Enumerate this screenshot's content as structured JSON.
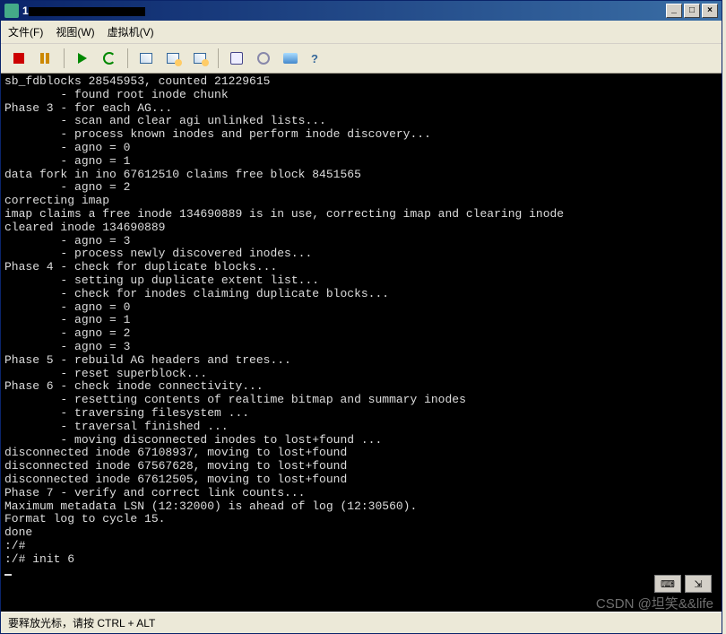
{
  "titlebar": {
    "prefix": "1",
    "redacted": true
  },
  "window_buttons": {
    "min": "_",
    "max": "□",
    "close": "×"
  },
  "menu": {
    "file": "文件(F)",
    "view": "视图(W)",
    "vm": "虚拟机(V)"
  },
  "toolbar": {
    "stop": "stop",
    "pause": "pause",
    "play": "play",
    "refresh": "refresh",
    "snapshot": "snapshot",
    "revert": "revert",
    "manage": "manage",
    "floppy": "floppy",
    "cd": "cd",
    "network": "network",
    "help": "help"
  },
  "terminal": {
    "lines": [
      "sb_fdblocks 28545953, counted 21229615",
      "        - found root inode chunk",
      "Phase 3 - for each AG...",
      "        - scan and clear agi unlinked lists...",
      "        - process known inodes and perform inode discovery...",
      "        - agno = 0",
      "        - agno = 1",
      "data fork in ino 67612510 claims free block 8451565",
      "        - agno = 2",
      "correcting imap",
      "imap claims a free inode 134690889 is in use, correcting imap and clearing inode",
      "cleared inode 134690889",
      "        - agno = 3",
      "        - process newly discovered inodes...",
      "Phase 4 - check for duplicate blocks...",
      "        - setting up duplicate extent list...",
      "        - check for inodes claiming duplicate blocks...",
      "        - agno = 0",
      "        - agno = 1",
      "        - agno = 2",
      "        - agno = 3",
      "Phase 5 - rebuild AG headers and trees...",
      "        - reset superblock...",
      "Phase 6 - check inode connectivity...",
      "        - resetting contents of realtime bitmap and summary inodes",
      "        - traversing filesystem ...",
      "        - traversal finished ...",
      "        - moving disconnected inodes to lost+found ...",
      "disconnected inode 67108937, moving to lost+found",
      "disconnected inode 67567628, moving to lost+found",
      "disconnected inode 67612505, moving to lost+found",
      "Phase 7 - verify and correct link counts...",
      "Maximum metadata LSN (12:32000) is ahead of log (12:30560).",
      "Format log to cycle 15.",
      "done",
      ":/#",
      ":/# init 6"
    ]
  },
  "corner": {
    "keyboard": "⌨",
    "expand": "⇲"
  },
  "statusbar": {
    "text": "要释放光标，请按 CTRL + ALT"
  },
  "watermark": {
    "text": "CSDN @坦笑&&life"
  }
}
